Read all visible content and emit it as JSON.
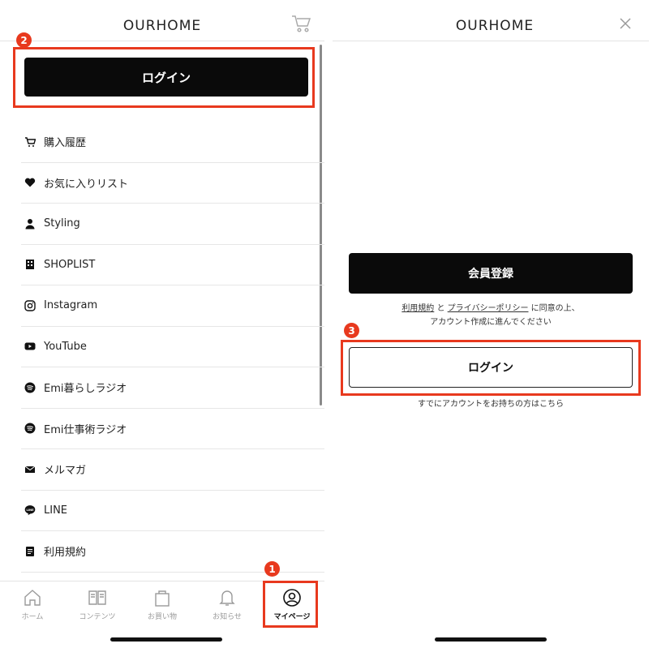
{
  "left": {
    "header_title": "OURHOME",
    "login_label": "ログイン",
    "badge_login": "2",
    "menu": [
      {
        "label": "購入履歴",
        "icon": "cart-icon"
      },
      {
        "label": "お気に入りリスト",
        "icon": "heart-icon"
      },
      {
        "label": "Styling",
        "icon": "person-icon"
      },
      {
        "label": "SHOPLIST",
        "icon": "building-icon"
      },
      {
        "label": "Instagram",
        "icon": "instagram-icon"
      },
      {
        "label": "YouTube",
        "icon": "youtube-icon"
      },
      {
        "label": "Emi暮らしラジオ",
        "icon": "spotify-icon"
      },
      {
        "label": "Emi仕事術ラジオ",
        "icon": "spotify-icon"
      },
      {
        "label": "メルマガ",
        "icon": "mail-icon"
      },
      {
        "label": "LINE",
        "icon": "line-icon"
      },
      {
        "label": "利用規約",
        "icon": "document-icon"
      }
    ],
    "tabs": [
      {
        "label": "ホーム",
        "icon": "home-icon"
      },
      {
        "label": "コンテンツ",
        "icon": "book-icon"
      },
      {
        "label": "お買い物",
        "icon": "bag-icon"
      },
      {
        "label": "お知らせ",
        "icon": "bell-icon"
      },
      {
        "label": "マイページ",
        "icon": "user-circle-icon"
      }
    ],
    "badge_tab": "1"
  },
  "right": {
    "header_title": "OURHOME",
    "register_label": "会員登録",
    "terms_link": "利用規約",
    "and_text": " と ",
    "privacy_link": "プライバシーポリシー",
    "agree_suffix": " に同意の上、",
    "agree_line2": "アカウント作成に進んでください",
    "login_label": "ログイン",
    "badge_login": "3",
    "already_text": "すでにアカウントをお持ちの方はこちら"
  },
  "colors": {
    "accent": "#e8391e",
    "button": "#0a0a0a"
  }
}
